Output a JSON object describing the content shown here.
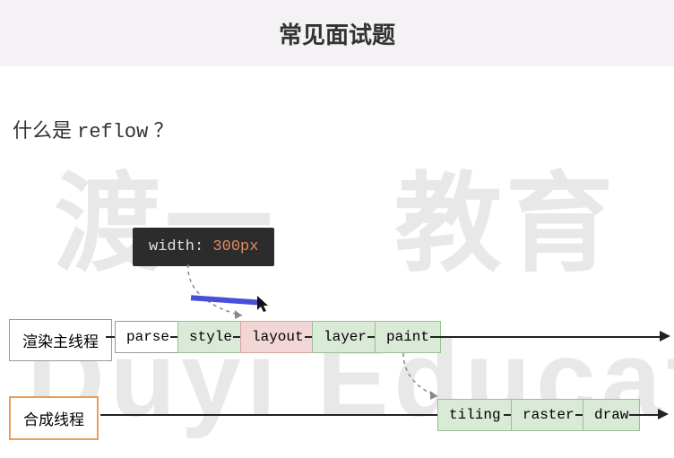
{
  "header": {
    "title": "常见面试题"
  },
  "question": {
    "prefix": "什么是 ",
    "code": "reflow",
    "suffix": " ？"
  },
  "code_sample": {
    "property": "width",
    "value": "300px"
  },
  "threads": {
    "main": {
      "label": "渲染主线程"
    },
    "compositor": {
      "label": "合成线程"
    }
  },
  "pipeline": {
    "main": [
      "parse",
      "style",
      "layout",
      "layer",
      "paint"
    ],
    "compositor": [
      "tiling",
      "raster",
      "draw"
    ]
  },
  "highlighted_stage": "layout",
  "watermark": {
    "cn1": "渡",
    "cn2": "一",
    "cn3": "教",
    "cn4": "育",
    "en": "Duyi Educati"
  }
}
